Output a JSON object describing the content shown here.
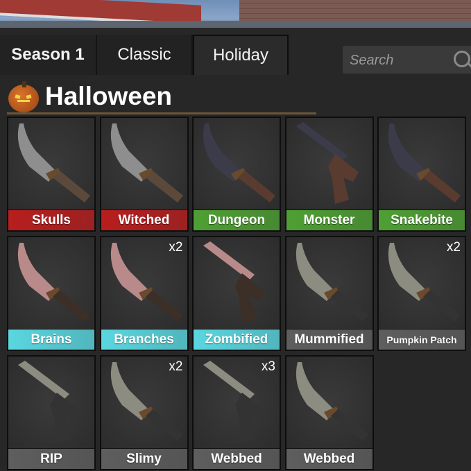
{
  "tabs": [
    {
      "label": "Season 1"
    },
    {
      "label": "Classic"
    },
    {
      "label": "Holiday"
    }
  ],
  "search": {
    "placeholder": "Search"
  },
  "section": {
    "title": "Halloween"
  },
  "colors": {
    "red": "#b81e1e",
    "green": "#4ea033",
    "cyan": "#5ad7e0",
    "gray": "#5e5e5e"
  },
  "items": [
    {
      "name": "Skulls",
      "rarity": "red",
      "count": ""
    },
    {
      "name": "Witched",
      "rarity": "red",
      "count": ""
    },
    {
      "name": "Dungeon",
      "rarity": "green",
      "count": ""
    },
    {
      "name": "Monster",
      "rarity": "green",
      "count": ""
    },
    {
      "name": "Snakebite",
      "rarity": "green",
      "count": ""
    },
    {
      "name": "Brains",
      "rarity": "cyan",
      "count": ""
    },
    {
      "name": "Branches",
      "rarity": "cyan",
      "count": "x2"
    },
    {
      "name": "Zombified",
      "rarity": "cyan",
      "count": ""
    },
    {
      "name": "Mummified",
      "rarity": "gray",
      "count": ""
    },
    {
      "name": "Pumpkin Patch",
      "rarity": "gray",
      "count": "x2"
    },
    {
      "name": "RIP",
      "rarity": "gray",
      "count": ""
    },
    {
      "name": "Slimy",
      "rarity": "gray",
      "count": "x2"
    },
    {
      "name": "Webbed",
      "rarity": "gray",
      "count": "x3"
    },
    {
      "name": "Webbed",
      "rarity": "gray",
      "count": ""
    }
  ]
}
